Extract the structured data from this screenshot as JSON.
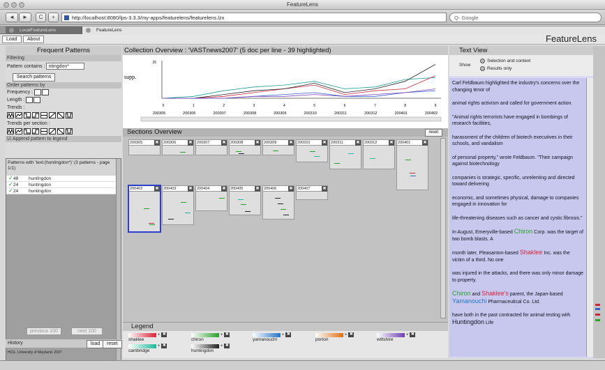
{
  "browser": {
    "window_title": "FeatureLens",
    "nav": {
      "back": "◄",
      "forward": "►",
      "reload": "C",
      "add": "+"
    },
    "url": "http://localhost:8080/lps-3.3.3/my-apps/featurelens/featurelens.lzx",
    "search_placeholder": "Q- Google",
    "tabs": [
      {
        "label": "LocalFeatureLens"
      },
      {
        "label": "FeatureLens"
      }
    ]
  },
  "app": {
    "load_label": "Load",
    "about_label": "About",
    "brand": "FeatureLens"
  },
  "left": {
    "title": "Frequent Patterns",
    "filtering_label": "Filtering",
    "pattern_contains_label": "Pattern contains :",
    "pattern_value": "ntingdon*",
    "search_button": "Search patterns",
    "order_label": "Order patterns by",
    "frequency_label": "Frequency :",
    "length_label": "Length :",
    "trends_label": "Trends :",
    "trends_per_section_label": "Trends per section :",
    "append_label": "Append pattern to legend",
    "patterns_header": "Patterns with 'text:(huntingdon*)' (3 patterns - page 1/1)",
    "patterns": [
      {
        "count": "48",
        "name": "huntingdon"
      },
      {
        "count": "24",
        "name": "huntingdon"
      },
      {
        "count": "24",
        "name": "huntingdon"
      }
    ],
    "prev_label": "previous 100",
    "next_label": "next 100",
    "history_label": "History",
    "history_load": "load",
    "history_reset": "reset",
    "credit": "HCIL, University of Maryland, 2007"
  },
  "collection": {
    "title": "Collection Overview : 'VASTnews2007' (5 doc per line - 39 highlighted)",
    "ylabel": "supp.",
    "ymax_label": "20",
    "x_ticks": [
      "0",
      "1",
      "2",
      "3",
      "4",
      "5",
      "6",
      "7",
      "8",
      "9"
    ],
    "months": [
      "200305",
      "200306",
      "200307",
      "200308",
      "200309",
      "200310",
      "200311",
      "200312",
      "200401",
      "200402"
    ]
  },
  "chart_data": {
    "type": "line",
    "x": [
      0,
      1,
      2,
      3,
      4,
      5,
      6,
      7,
      8,
      9
    ],
    "ylabel": "supp.",
    "ylim": [
      0,
      20
    ],
    "series": [
      {
        "color": "#1f9a9a",
        "values": [
          0,
          1,
          4,
          6,
          7,
          9,
          5,
          6,
          10,
          11
        ]
      },
      {
        "color": "#c8283c",
        "values": [
          0,
          0,
          1,
          3,
          5,
          7,
          2,
          4,
          5,
          12
        ]
      },
      {
        "color": "#222222",
        "values": [
          0,
          0,
          2,
          4,
          5,
          8,
          3,
          5,
          9,
          18
        ]
      },
      {
        "color": "#3a5fcd",
        "values": [
          0,
          0,
          0,
          1,
          2,
          3,
          1,
          1,
          3,
          4
        ]
      },
      {
        "color": "#7c46b8",
        "values": [
          0,
          0,
          0,
          1,
          1,
          2,
          1,
          2,
          3,
          5
        ]
      }
    ]
  },
  "sections": {
    "title": "Sections Overview",
    "reset_label": "reset",
    "close_glyph": "✖",
    "items": [
      {
        "label": "200305"
      },
      {
        "label": "200306"
      },
      {
        "label": "200307"
      },
      {
        "label": "200308"
      },
      {
        "label": "200309"
      },
      {
        "label": "200310"
      },
      {
        "label": "200311"
      },
      {
        "label": "200312"
      },
      {
        "label": "200401"
      },
      {
        "label": "200402"
      },
      {
        "label": "200403"
      },
      {
        "label": "200404"
      },
      {
        "label": "200405"
      },
      {
        "label": "200406"
      },
      {
        "label": "200407"
      }
    ]
  },
  "legend": {
    "title": "Legend",
    "items": [
      {
        "name": "shaklee",
        "color": "#d8243a"
      },
      {
        "name": "chiron",
        "color": "#2aa02a"
      },
      {
        "name": "yamanouchi",
        "color": "#2673c9"
      },
      {
        "name": "porton",
        "color": "#e07010"
      },
      {
        "name": "wiltshire",
        "color": "#6a3fb0"
      },
      {
        "name": "cambridge",
        "color": "#20b89a"
      },
      {
        "name": "huntingdon",
        "color": "#222222"
      }
    ]
  },
  "textview": {
    "title": "Text View",
    "show_label": "Show",
    "opt1": "Selection and context",
    "opt2": "Results only",
    "p1": "Carl Feldbaum highlighted the industry's concerns over the changing tenor of",
    "p2": "animal rights activism and called for government action.",
    "p3": "\"Animal rights terrorists have engaged in bombings of research facilities,",
    "p4": "harassment of the children of biotech executives in their schools, and vandalism",
    "p5": "of personal property,\" wrote Feldbaum. \"Their campaign against biotechnology",
    "p6": "companies is strategic, specific, unrelenting and directed toward delivering",
    "p7": "economic, and sometimes physical, damage to companies engaged in innovation for",
    "p8": "life-threatening diseases such as cancer and cystic fibrosis.\"",
    "p9a": "In August, Emeryville-based ",
    "p9b": "Chiron",
    "p9c": " Corp. was the target of two bomb blasts. A",
    "p10a": "month later, Pleasanton-based ",
    "p10b": "Shaklee",
    "p10c": " Inc. was the victim of a third. No one",
    "p11": "was injured in the attacks, and there was only minor damage to property.",
    "p12a": "Chiron",
    "p12b": " and ",
    "p12c": "Shaklee's",
    "p12d": " parent, the Japan-based ",
    "p12e": "Yamanouchi",
    "p12f": " Pharmaceutical Co. Ltd.",
    "p13a": "have both in the past contracted for animal testing with ",
    "p13b": "Huntingdon",
    "p13c": " Life"
  }
}
